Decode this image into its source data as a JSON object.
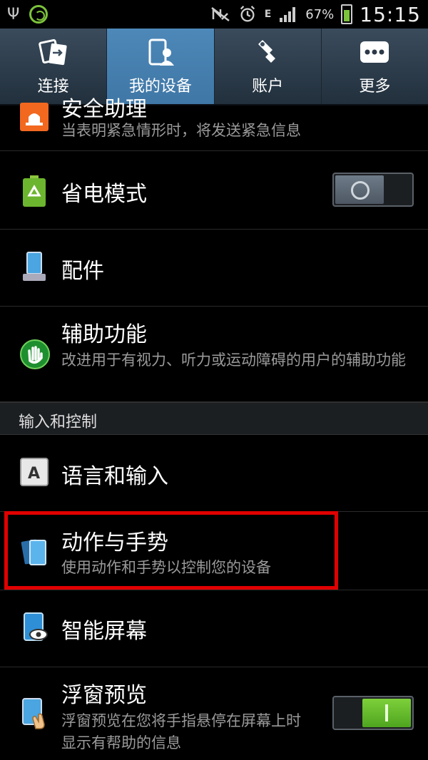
{
  "status_bar": {
    "battery_percent": "67%",
    "time": "15:15",
    "network_label": "E"
  },
  "tabs": [
    {
      "label": "连接",
      "icon": "connect-icon",
      "active": false
    },
    {
      "label": "我的设备",
      "icon": "my-device-icon",
      "active": true
    },
    {
      "label": "账户",
      "icon": "key-icon",
      "active": false
    },
    {
      "label": "更多",
      "icon": "more-icon",
      "active": false
    }
  ],
  "settings": {
    "emergency": {
      "title": "安全助理",
      "subtitle": "当表明紧急情形时，将发送紧急信息"
    },
    "power_saving": {
      "title": "省电模式",
      "toggle": "off"
    },
    "accessories": {
      "title": "配件"
    },
    "accessibility": {
      "title": "辅助功能",
      "subtitle": "改进用于有视力、听力或运动障碍的用户的辅助功能"
    },
    "section_input": "输入和控制",
    "language": {
      "title": "语言和输入"
    },
    "motions": {
      "title": "动作与手势",
      "subtitle": "使用动作和手势以控制您的设备"
    },
    "smart_screen": {
      "title": "智能屏幕"
    },
    "air_view": {
      "title": "浮窗预览",
      "subtitle": "浮窗预览在您将手指悬停在屏幕上时显示有帮助的信息",
      "toggle": "on"
    }
  },
  "colors": {
    "tab_active": "#4d88b8",
    "toggle_on": "#6cc12e",
    "highlight": "#e10000"
  }
}
